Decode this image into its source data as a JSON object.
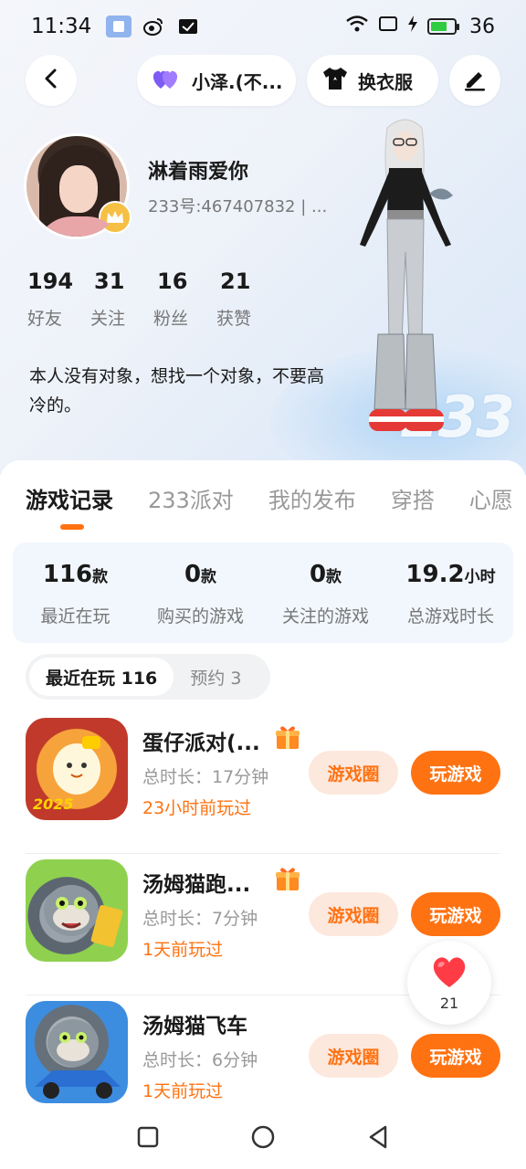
{
  "status_bar": {
    "time": "11:34",
    "battery": "36"
  },
  "header": {
    "friend_label": "小泽.(不...",
    "outfit_label": "换衣服"
  },
  "profile": {
    "username": "淋着雨爱你",
    "uid": "233号:467407832 | ...",
    "stats": [
      {
        "value": "194",
        "label": "好友"
      },
      {
        "value": "31",
        "label": "关注"
      },
      {
        "value": "16",
        "label": "粉丝"
      },
      {
        "value": "21",
        "label": "获赞"
      }
    ],
    "bio": "本人没有对象，想找一个对象，不要高冷的。"
  },
  "watermark": "233",
  "tabs": [
    "游戏记录",
    "233派对",
    "我的发布",
    "穿搭",
    "心愿"
  ],
  "summary": [
    {
      "value": "116",
      "unit": "款",
      "label": "最近在玩"
    },
    {
      "value": "0",
      "unit": "款",
      "label": "购买的游戏"
    },
    {
      "value": "0",
      "unit": "款",
      "label": "关注的游戏"
    },
    {
      "value": "19.2",
      "unit": "小时",
      "label": "总游戏时长"
    }
  ],
  "subtabs": [
    "最近在玩 116",
    "预约 3"
  ],
  "games": [
    {
      "name": "蛋仔派对(...",
      "duration": "总时长：17分钟",
      "last_played": "23小时前玩过",
      "has_gift": true,
      "icon_tag": "2025"
    },
    {
      "name": "汤姆猫跑...",
      "duration": "总时长：7分钟",
      "last_played": "1天前玩过",
      "has_gift": true,
      "icon_tag": ""
    },
    {
      "name": "汤姆猫飞车",
      "duration": "总时长：6分钟",
      "last_played": "1天前玩过",
      "has_gift": false,
      "icon_tag": ""
    }
  ],
  "buttons": {
    "circle": "游戏圈",
    "play": "玩游戏"
  },
  "like_float": {
    "count": "21"
  },
  "colors": {
    "accent": "#ff7212",
    "accent_soft": "#fde8dd",
    "summary_bg": "#f2f7fd"
  }
}
